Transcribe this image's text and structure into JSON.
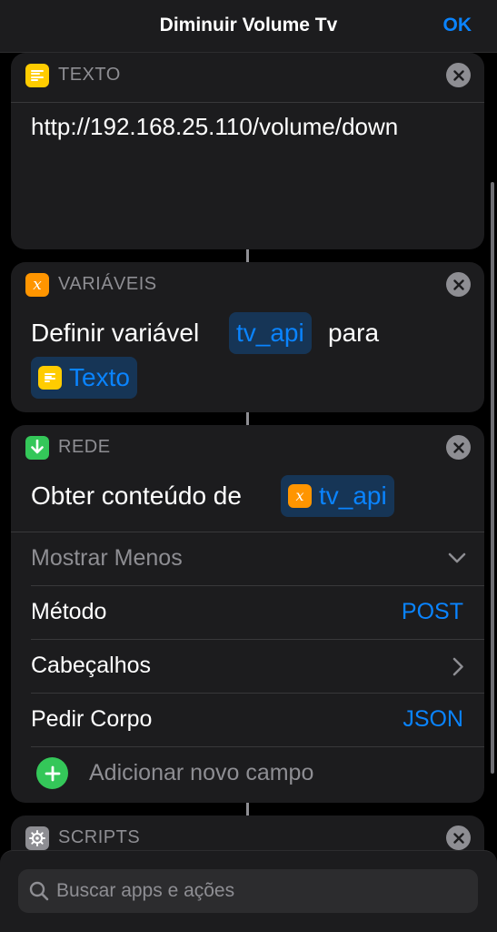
{
  "nav": {
    "title": "Diminuir Volume Tv",
    "done_label": "OK"
  },
  "actions": [
    {
      "category": "TEXTO",
      "text": "http://192.168.25.110/volume/down"
    },
    {
      "category": "VARIÁVEIS",
      "prefix": "Definir variável",
      "variable": "tv_api",
      "conj": "para",
      "source_token": "Texto"
    },
    {
      "category": "REDE",
      "prefix": "Obter conteúdo de",
      "variable": "tv_api",
      "rows": [
        {
          "label": "Mostrar Menos"
        },
        {
          "label": "Método",
          "value": "POST"
        },
        {
          "label": "Cabeçalhos"
        },
        {
          "label": "Pedir Corpo",
          "value": "JSON"
        },
        {
          "label": "Adicionar novo campo"
        }
      ]
    },
    {
      "category": "SCRIPTS"
    }
  ],
  "search": {
    "placeholder": "Buscar apps e ações"
  },
  "colors": {
    "accent": "#0a84ff",
    "texto": "#ffcc00",
    "variaveis": "#ff9500",
    "rede": "#34c759",
    "scripts": "#8e8e93"
  },
  "icons": {
    "texto": "text-lines-icon",
    "variaveis": "variable-x-icon",
    "rede": "download-arrow-icon",
    "scripts": "gear-icon",
    "remove": "close-icon",
    "collapse": "chevron-down-icon",
    "headers": "chevron-right-icon",
    "add": "plus-icon",
    "search": "search-icon"
  }
}
